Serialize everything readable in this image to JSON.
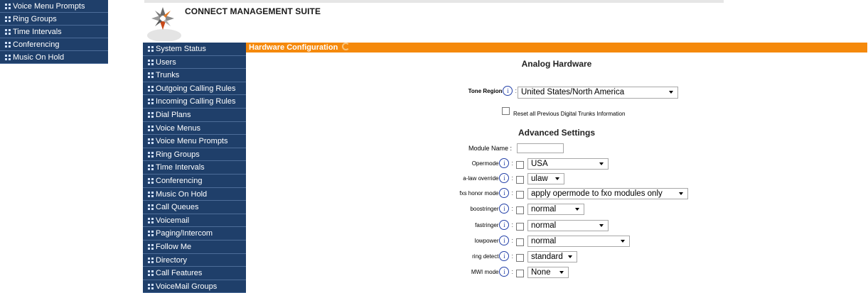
{
  "top_fragment": {
    "items": [
      "Voice Menu Prompts",
      "Ring Groups",
      "Time Intervals",
      "Conferencing",
      "Music On Hold"
    ]
  },
  "brand": {
    "title": "CONNECT MANAGEMENT SUITE"
  },
  "sidebar": {
    "items": [
      "System Status",
      "Users",
      "Trunks",
      "Outgoing Calling Rules",
      "Incoming Calling Rules",
      "Dial Plans",
      "Voice Menus",
      "Voice Menu Prompts",
      "Ring Groups",
      "Time Intervals",
      "Conferencing",
      "Music On Hold",
      "Call Queues",
      "Voicemail",
      "Paging/Intercom",
      "Follow Me",
      "Directory",
      "Call Features",
      "VoiceMail Groups"
    ]
  },
  "main": {
    "section_title": "Hardware Configuration",
    "analog_heading": "Analog Hardware",
    "tone_region": {
      "label": "Tone Region",
      "value": "United States/North America"
    },
    "reset_label": "Reset all Previous Digital Trunks Information",
    "advanced_heading": "Advanced Settings",
    "module_name_label": "Module Name :",
    "module_name_value": "",
    "colon": ":",
    "settings": [
      {
        "label": "Opermode",
        "value": "USA"
      },
      {
        "label": "a-law override",
        "value": "ulaw"
      },
      {
        "label": "fxs honor mode",
        "value": "apply opermode to fxo modules only"
      },
      {
        "label": "boostringer",
        "value": "normal"
      },
      {
        "label": "fastringer",
        "value": "normal"
      },
      {
        "label": "lowpower",
        "value": "normal"
      },
      {
        "label": "ring detect",
        "value": "standard"
      },
      {
        "label": "MWI mode",
        "value": "None"
      }
    ]
  },
  "colors": {
    "nav_bg": "#1f3f6a",
    "header_bar": "#f5890b",
    "info_icon": "#2340a8"
  }
}
